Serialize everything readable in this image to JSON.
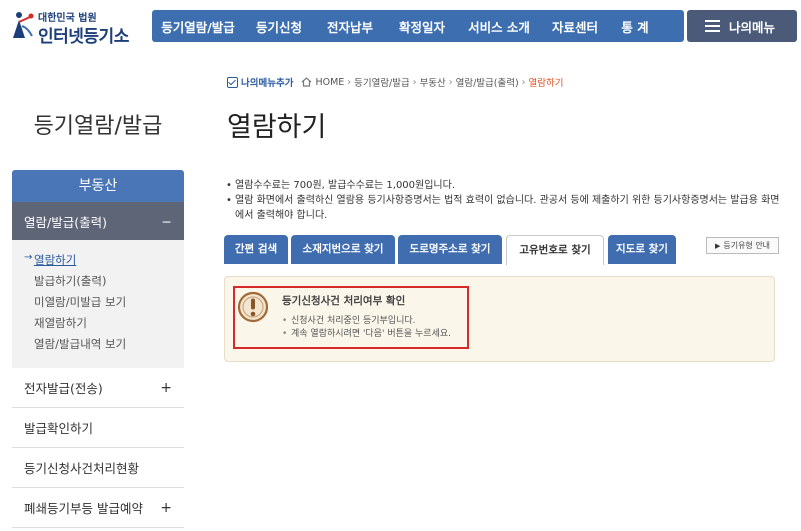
{
  "header": {
    "logo_sub": "대한민국 법원",
    "logo_main": "인터넷등기소",
    "nav": [
      "등기열람/발급",
      "등기신청",
      "전자납부",
      "확정일자",
      "서비스 소개",
      "자료센터",
      "통 계"
    ],
    "my_menu": "나의메뉴"
  },
  "breadcrumb": {
    "my_menu_add": "나의메뉴추가",
    "items": [
      "HOME",
      "등기열람/발급",
      "부동산",
      "열람/발급(출력)"
    ],
    "current": "열람하기"
  },
  "sidebar": {
    "title": "등기열람/발급",
    "category": "부동산",
    "open_menu": "열람/발급(출력)",
    "open_toggle": "−",
    "sub_items": [
      "열람하기",
      "발급하기(출력)",
      "미열람/미발급 보기",
      "재열람하기",
      "열람/발급내역 보기"
    ],
    "menus": [
      {
        "label": "전자발급(전송)",
        "toggle": "+"
      },
      {
        "label": "발급확인하기",
        "toggle": ""
      },
      {
        "label": "등기신청사건처리현황",
        "toggle": ""
      },
      {
        "label": "폐쇄등기부등 발급예약",
        "toggle": "+"
      }
    ]
  },
  "main": {
    "title": "열람하기",
    "notices": [
      "열람수수료는 700원, 발급수수료는 1,000원입니다.",
      "열람 화면에서 출력하신 열람용 등기사항증명서는 법적 효력이 없습니다. 관공서 등에 제출하기 위한 등기사항증명서는 발급용 화면에서 출력해야 합니다."
    ],
    "tabs": [
      "간편 검색",
      "소재지번으로 찾기",
      "도로명주소로 찾기",
      "고유번호로 찾기",
      "지도로 찾기"
    ],
    "active_tab": "고유번호로 찾기",
    "guide_button": "등기유형 안내",
    "alert": {
      "title": "등기신청사건 처리여부 확인",
      "lines": [
        "신청사건 처리중인 등기부입니다.",
        "계속 열람하시려면 '다음' 버튼을 누르세요."
      ]
    }
  },
  "colors": {
    "nav_bg": "#3d6fb0",
    "my_menu_bg": "#4a5a78",
    "side_category_bg": "#4a76b8",
    "side_open_bg": "#5e6576",
    "alert_border": "#d42a2a",
    "panel_bg": "#fbf6ea",
    "breadcrumb_current": "#e05020"
  }
}
